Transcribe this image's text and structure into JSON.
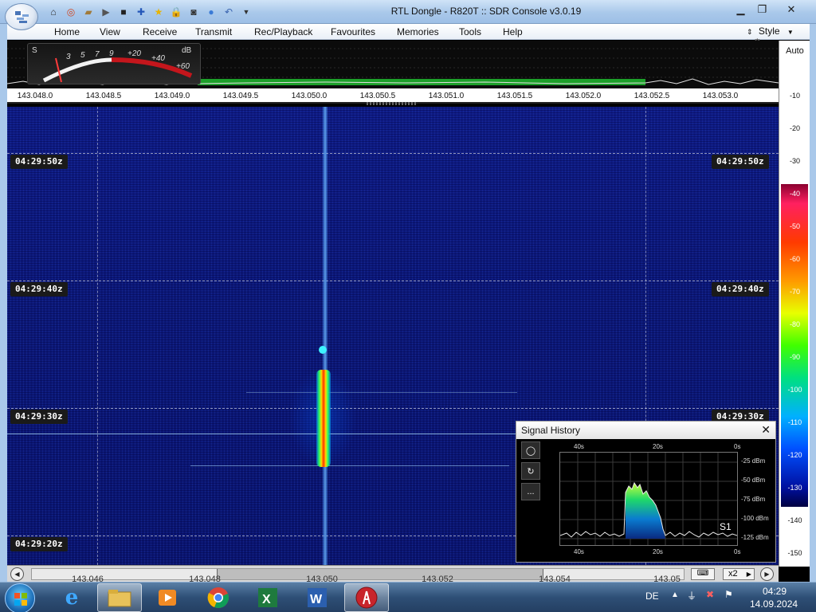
{
  "window": {
    "title": "RTL Dongle - R820T :: SDR Console v3.0.19",
    "controls": [
      "minimize",
      "maximize",
      "close"
    ]
  },
  "quick_access_icons": [
    "home-icon",
    "lifebuoy-icon",
    "folder-icon",
    "play-icon",
    "stop-icon",
    "add-icon",
    "star-icon",
    "lock-icon",
    "camera-icon",
    "drop-icon",
    "undo-icon",
    "dropdown-icon"
  ],
  "menu": {
    "items": [
      "Home",
      "View",
      "Receive",
      "Transmit",
      "Rec/Playback",
      "Favourites",
      "Memories",
      "Tools",
      "Help"
    ],
    "style_label": "Style"
  },
  "smeter": {
    "s_label": "S",
    "s_ticks": [
      "3",
      "5",
      "7",
      "9"
    ],
    "plus_ticks": [
      "+20",
      "+40",
      "+60"
    ],
    "unit": "dB"
  },
  "frequency_axis": {
    "ticks": [
      "143.048.0",
      "143.048.5",
      "143.049.0",
      "143.049.5",
      "143.050.0",
      "143.050.5",
      "143.051.0",
      "143.051.5",
      "143.052.0",
      "143.052.5",
      "143.053.0"
    ]
  },
  "waterfall": {
    "time_labels": [
      "04:29:50z",
      "04:29:40z",
      "04:29:30z",
      "04:29:20z"
    ]
  },
  "db_scale": {
    "auto_label": "Auto",
    "values": [
      "-10",
      "-20",
      "-30",
      "-40",
      "-50",
      "-60",
      "-70",
      "-80",
      "-90",
      "-100",
      "-110",
      "-120",
      "-130",
      "-140",
      "-150"
    ]
  },
  "bottom_strip": {
    "ticks": [
      "143.046",
      "143.048",
      "143.050",
      "143.052",
      "143.054",
      "143.05"
    ],
    "zoom": "x2"
  },
  "signal_history": {
    "title": "Signal History",
    "time_axis_top": [
      "40s",
      "20s",
      "0s"
    ],
    "time_axis_bottom": [
      "40s",
      "20s",
      "0s"
    ],
    "level_axis": [
      "-25 dBm",
      "-50 dBm",
      "-75 dBm",
      "-100 dBm",
      "-125 dBm"
    ],
    "s_unit": "S1",
    "more_label": "..."
  },
  "taskbar": {
    "apps": [
      "internet-explorer-icon",
      "file-explorer-icon",
      "media-player-icon",
      "chrome-icon",
      "excel-icon",
      "word-icon",
      "sdr-console-icon"
    ],
    "language": "DE",
    "time": "04:29",
    "date": "14.09.2024"
  }
}
